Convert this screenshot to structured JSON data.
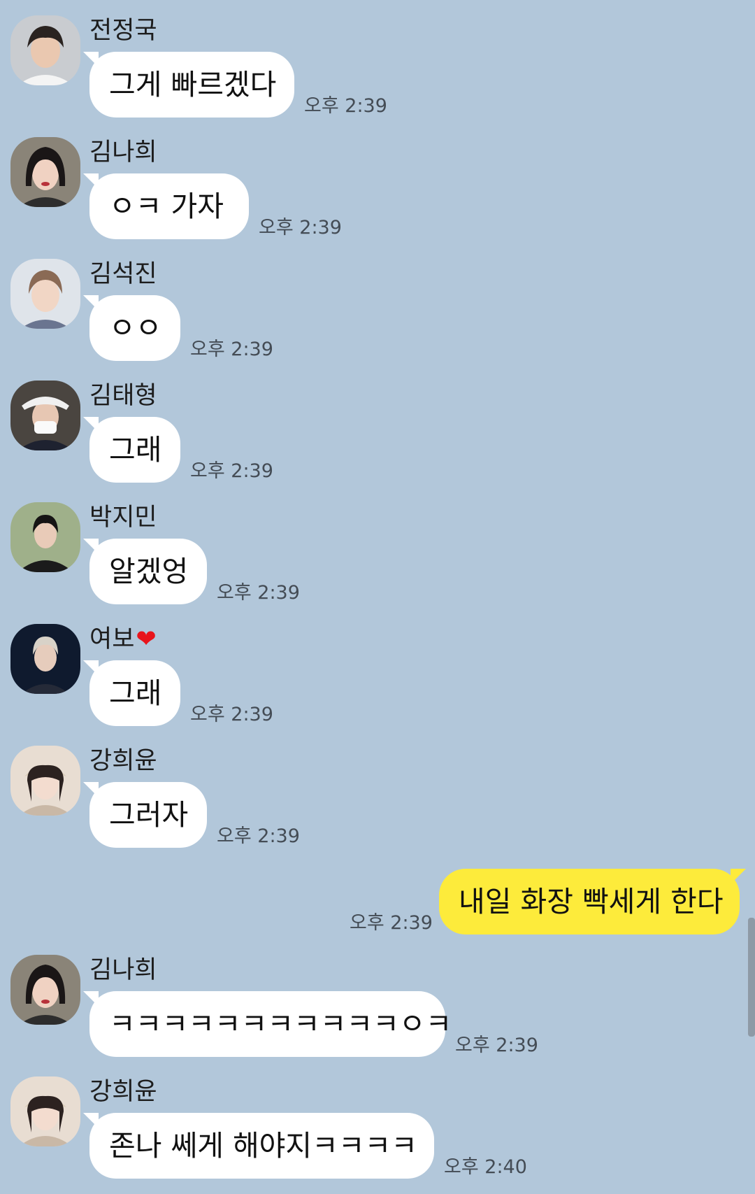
{
  "messages": [
    {
      "sender": "전정국",
      "text": "그게 빠르겠다",
      "time": "오후 2:39"
    },
    {
      "sender": "김나희",
      "text": "ㅇㅋ 가자",
      "time": "오후 2:39"
    },
    {
      "sender": "김석진",
      "text": "ㅇㅇ",
      "time": "오후 2:39"
    },
    {
      "sender": "김태형",
      "text": "그래",
      "time": "오후 2:39"
    },
    {
      "sender": "박지민",
      "text": "알겠엉",
      "time": "오후 2:39"
    },
    {
      "sender": "여보",
      "sender_emoji": "❤",
      "text": "그래",
      "time": "오후 2:39"
    },
    {
      "sender": "강희윤",
      "text": "그러자",
      "time": "오후 2:39"
    },
    {
      "text": "내일 화장 빡세게 한다",
      "time": "오후 2:39"
    },
    {
      "sender": "김나희",
      "text": "ㅋㅋㅋㅋㅋㅋㅋㅋㅋㅋㅋㅇㅋ",
      "time": "오후 2:39"
    },
    {
      "sender": "강희윤",
      "text": "존나 쎄게 해야지ㅋㅋㅋㅋ",
      "time": "오후 2:40"
    }
  ],
  "colors": {
    "background": "#b2c7da",
    "incoming_bubble": "#ffffff",
    "outgoing_bubble": "#fdeb3b",
    "heart": "#e8141b"
  }
}
